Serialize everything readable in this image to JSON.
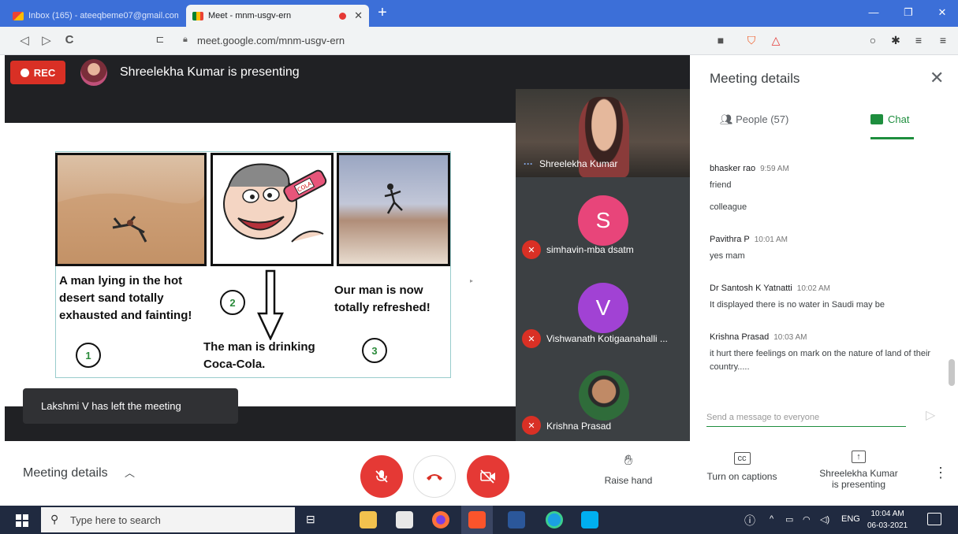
{
  "browser": {
    "tabs": [
      {
        "label": "Inbox (165) - ateeqbeme07@gmail.com",
        "active": false
      },
      {
        "label": "Meet - mnm-usgv-ern",
        "active": true
      }
    ],
    "new_tab_label": "+",
    "url": "meet.google.com/mnm-usgv-ern"
  },
  "meeting": {
    "rec_label": "REC",
    "presenting_text": "Shreelekha Kumar is presenting",
    "toast": "Lakshmi V has left the meeting"
  },
  "slide": {
    "caption1_lines": [
      "A man lying in the hot",
      "desert sand totally",
      "exhausted and fainting!"
    ],
    "caption2_lines": [
      "The man is drinking",
      "Coca-Cola."
    ],
    "caption3_lines": [
      "Our man is now",
      "totally refreshed!"
    ],
    "numbers": [
      "1",
      "2",
      "3"
    ],
    "bottle_label": "COLA"
  },
  "participants": [
    {
      "name": "Shreelekha Kumar",
      "muted": false
    },
    {
      "name": "simhavin-mba dsatm",
      "initial": "S",
      "color": "#e8457a",
      "muted": true
    },
    {
      "name": "Vishwanath Kotigaanahalli ...",
      "initial": "V",
      "color": "#a142d4",
      "muted": true
    },
    {
      "name": "Krishna Prasad",
      "muted": true
    }
  ],
  "side_panel": {
    "title": "Meeting details",
    "people_tab": "People (57)",
    "chat_tab": "Chat",
    "messages": [
      {
        "sender": "bhasker rao",
        "time": "9:59 AM",
        "lines": [
          "friend",
          "colleague"
        ]
      },
      {
        "sender": "Pavithra P",
        "time": "10:01 AM",
        "lines": [
          "yes mam"
        ]
      },
      {
        "sender": "Dr Santosh K Yatnatti",
        "time": "10:02 AM",
        "lines": [
          "It displayed there is no water in Saudi may be"
        ]
      },
      {
        "sender": "Krishna Prasad",
        "time": "10:03 AM",
        "lines": [
          "it hurt there feelings on mark on the nature of land of  their country....."
        ]
      }
    ],
    "input_placeholder": "Send a message to everyone"
  },
  "bottom_bar": {
    "meeting_details": "Meeting details",
    "raise_hand": "Raise hand",
    "captions": "Turn on captions",
    "presenting_lines": [
      "Shreelekha Kumar",
      "is presenting"
    ]
  },
  "taskbar": {
    "search_placeholder": "Type here to search",
    "lang": "ENG",
    "time": "10:04 AM",
    "date": "06-03-2021"
  },
  "colors": {
    "accent_green": "#1e8e3e",
    "danger_red": "#e53935",
    "browser_blue": "#3c6fd8"
  },
  "icons": [
    "gmail-icon",
    "meet-icon",
    "close-icon",
    "back-icon",
    "forward-icon",
    "reload-icon",
    "bookmark-icon",
    "lock-icon",
    "camera-icon",
    "brave-shield-icon",
    "brave-rewards-icon",
    "extensions-icon",
    "puzzle-icon",
    "playlist-icon",
    "menu-icon",
    "mic-off-icon",
    "hangup-icon",
    "video-off-icon",
    "hand-icon",
    "captions-icon",
    "present-icon",
    "more-icon",
    "people-icon",
    "chat-icon",
    "send-icon",
    "windows-icon",
    "search-icon"
  ]
}
